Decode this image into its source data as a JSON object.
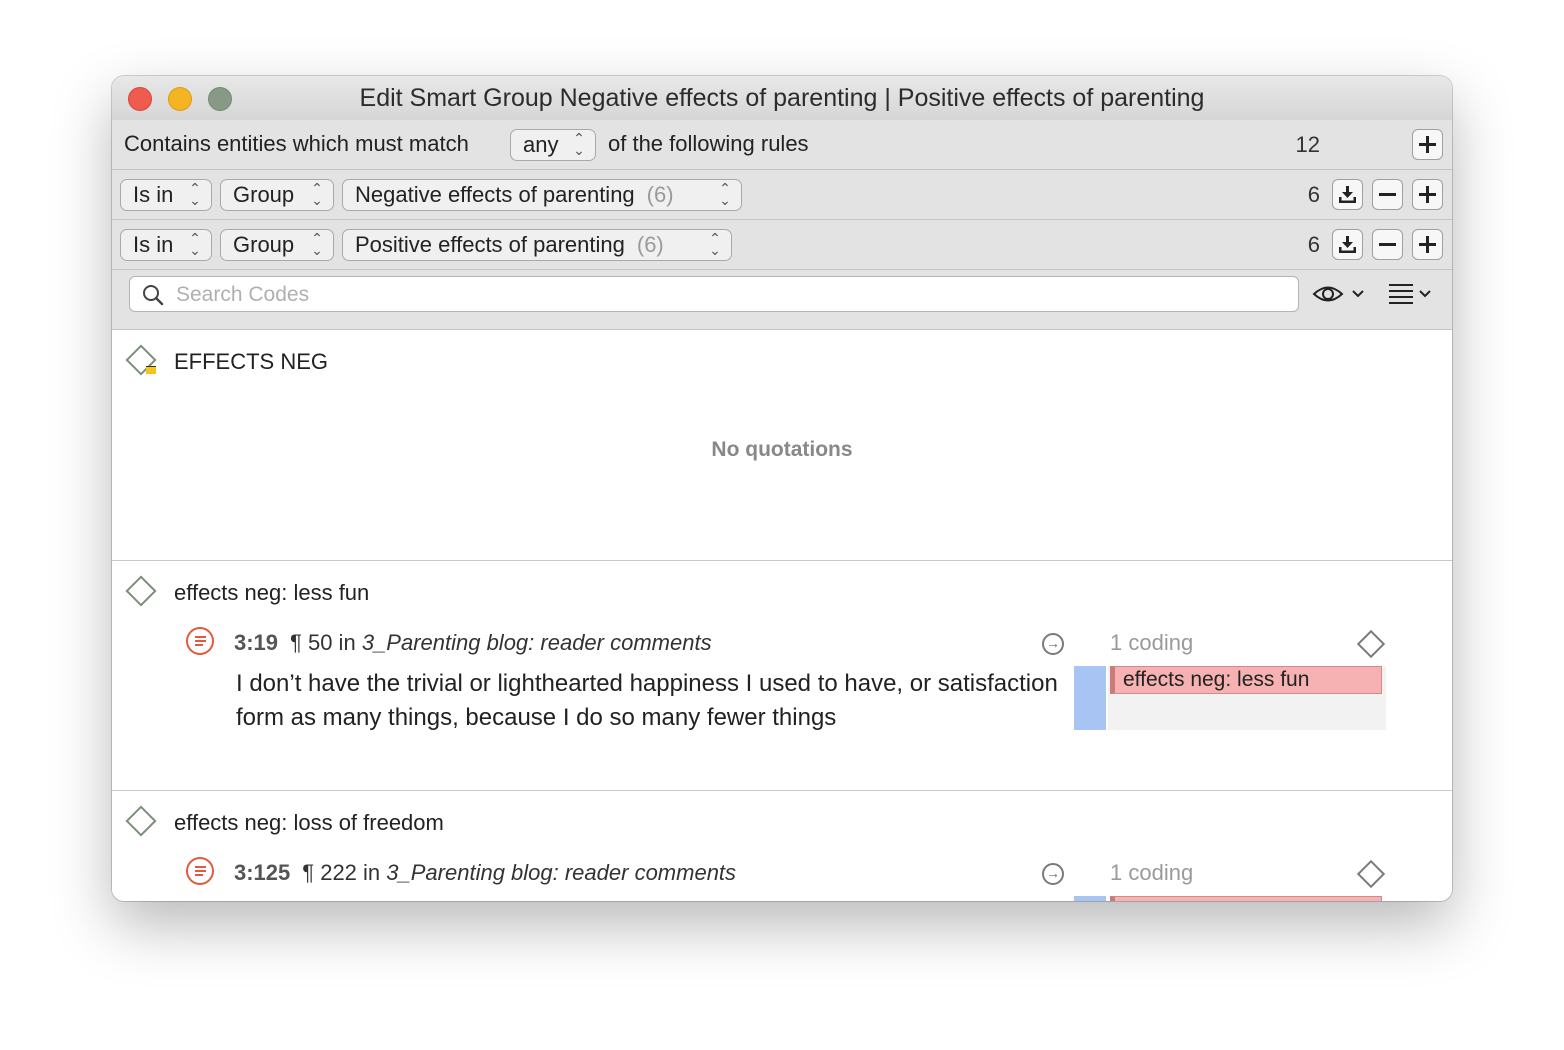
{
  "window": {
    "title": "Edit Smart Group Negative effects of parenting | Positive effects of parenting"
  },
  "match_row": {
    "prefix": "Contains entities which must match",
    "operator": "any",
    "suffix": "of the following rules",
    "count": "12"
  },
  "rules": [
    {
      "relation": "Is in",
      "type": "Group",
      "target": "Negative effects of parenting",
      "target_count": "(6)",
      "count": "6"
    },
    {
      "relation": "Is in",
      "type": "Group",
      "target": "Positive effects of parenting",
      "target_count": "(6)",
      "count": "6"
    }
  ],
  "search": {
    "placeholder": "Search Codes"
  },
  "codes": [
    {
      "name": "EFFECTS NEG",
      "empty_label": "No quotations"
    },
    {
      "name": "effects neg: less fun",
      "quotation": {
        "id": "3:19",
        "para": "¶ 50 in",
        "doc": "3_Parenting blog: reader comments",
        "codings": "1 coding",
        "text": "I don’t have the trivial or lighthearted happiness I used to have, or satisfaction form as many things, because I do so many fewer things",
        "tag": "effects neg: less fun"
      }
    },
    {
      "name": "effects neg: loss of freedom",
      "quotation": {
        "id": "3:125",
        "para": "¶ 222 in",
        "doc": "3_Parenting blog: reader comments",
        "codings": "1 coding"
      }
    }
  ],
  "icons": {
    "search": "search-icon",
    "eye": "eye-icon",
    "list": "list-icon",
    "import": "import-icon",
    "minus": "minus-icon",
    "plus": "plus-icon"
  },
  "colors": {
    "close": "#ed5c4f",
    "minimize": "#f5b422",
    "zoom": "#879a85",
    "quotation_icon": "#e05a3e",
    "code_tag": "#f6b2b2",
    "margin_bar": "#a7c4f2"
  }
}
